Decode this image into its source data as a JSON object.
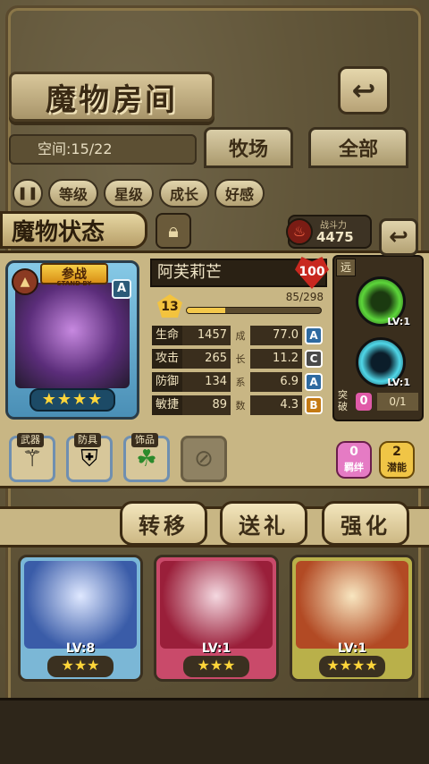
{
  "header": {
    "title": "魔物房间",
    "back_icon": "back-arrow-icon"
  },
  "room": {
    "space_text": "空间:15/22"
  },
  "tabs": [
    {
      "label": "牧场"
    },
    {
      "label": "全部"
    }
  ],
  "filters": [
    "等级",
    "星级",
    "成长",
    "好感"
  ],
  "status_panel": {
    "title": "魔物状态",
    "power_label": "战斗力",
    "power_value": "4475",
    "monster": {
      "name": "阿芙莉芒",
      "badge_top": "参战",
      "badge_sub": "STAND BY",
      "hp_heart": "100",
      "level": "13",
      "exp_text": "85/298",
      "exp_fraction": 0.285,
      "rank": "A",
      "stars": "★★★★",
      "star_count": 4
    },
    "stats": [
      {
        "label": "生命",
        "value": "1457",
        "growth": "77.0",
        "grade": "A",
        "grade_color": "#2e6aa0"
      },
      {
        "label": "攻击",
        "value": "265",
        "growth": "11.2",
        "grade": "C",
        "grade_color": "#4a4a4a"
      },
      {
        "label": "防御",
        "value": "134",
        "growth": "6.9",
        "grade": "A",
        "grade_color": "#2e6aa0"
      },
      {
        "label": "敏捷",
        "value": "89",
        "growth": "4.3",
        "grade": "B",
        "grade_color": "#c47a14"
      }
    ],
    "growth_column": [
      "成",
      "长",
      "系",
      "数"
    ],
    "range_tag": "远",
    "skills": [
      {
        "name": "skill-1",
        "level": "LV:1"
      },
      {
        "name": "skill-2",
        "level": "LV:1"
      }
    ],
    "breakthrough": {
      "label": "突破",
      "count": "0",
      "progress": "0/1"
    },
    "equipment": [
      {
        "label": "武器",
        "icon": "scepter-icon",
        "glyph": "⚚"
      },
      {
        "label": "防具",
        "icon": "shield-icon",
        "glyph": "⛨"
      },
      {
        "label": "饰品",
        "icon": "clover-icon",
        "glyph": "☘"
      },
      {
        "label": "",
        "icon": "empty-slot-icon",
        "glyph": "⊘"
      }
    ],
    "bond": {
      "value": "0",
      "label": "羁绊"
    },
    "potential": {
      "value": "2",
      "label": "潜能"
    }
  },
  "actions": [
    "转移",
    "送礼",
    "强化"
  ],
  "monsters": [
    {
      "level": "LV:8",
      "stars": "★★★"
    },
    {
      "level": "LV:1",
      "stars": "★★★"
    },
    {
      "level": "LV:1",
      "stars": "★★★★"
    }
  ]
}
